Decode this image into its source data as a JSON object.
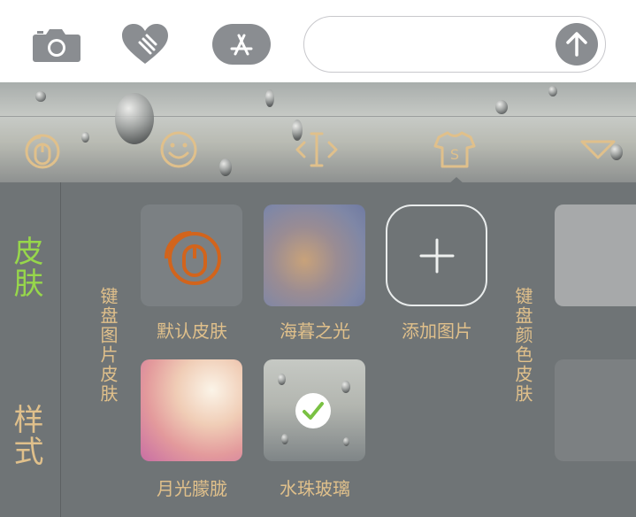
{
  "composer": {
    "icons": [
      "camera-icon",
      "heart-touch-icon",
      "app-store-icon",
      "send-arrow-icon"
    ],
    "input_value": ""
  },
  "keyboard_toolbar": {
    "icons": [
      "keyboard-mouse-logo-icon",
      "emoji-icon",
      "cursor-icon",
      "skin-shirt-icon",
      "collapse-icon"
    ],
    "selected": "skin-shirt-icon"
  },
  "sidebar": {
    "items": [
      {
        "label": "皮肤",
        "active": true
      },
      {
        "label": "样式",
        "active": false
      }
    ]
  },
  "image_skins": {
    "section_label": "键盘图片皮肤",
    "tiles": [
      {
        "label": "默认皮肤",
        "selected": false
      },
      {
        "label": "海暮之光",
        "selected": false
      },
      {
        "label": "添加图片",
        "selected": false
      },
      {
        "label": "月光朦胧",
        "selected": false
      },
      {
        "label": "水珠玻璃",
        "selected": true
      }
    ]
  },
  "color_skins": {
    "section_label": "键盘颜色皮肤"
  },
  "colors": {
    "active_tab": "#97d74b",
    "label": "#e0c08b",
    "logo": "#d2641c",
    "panel": "#6f7476"
  }
}
